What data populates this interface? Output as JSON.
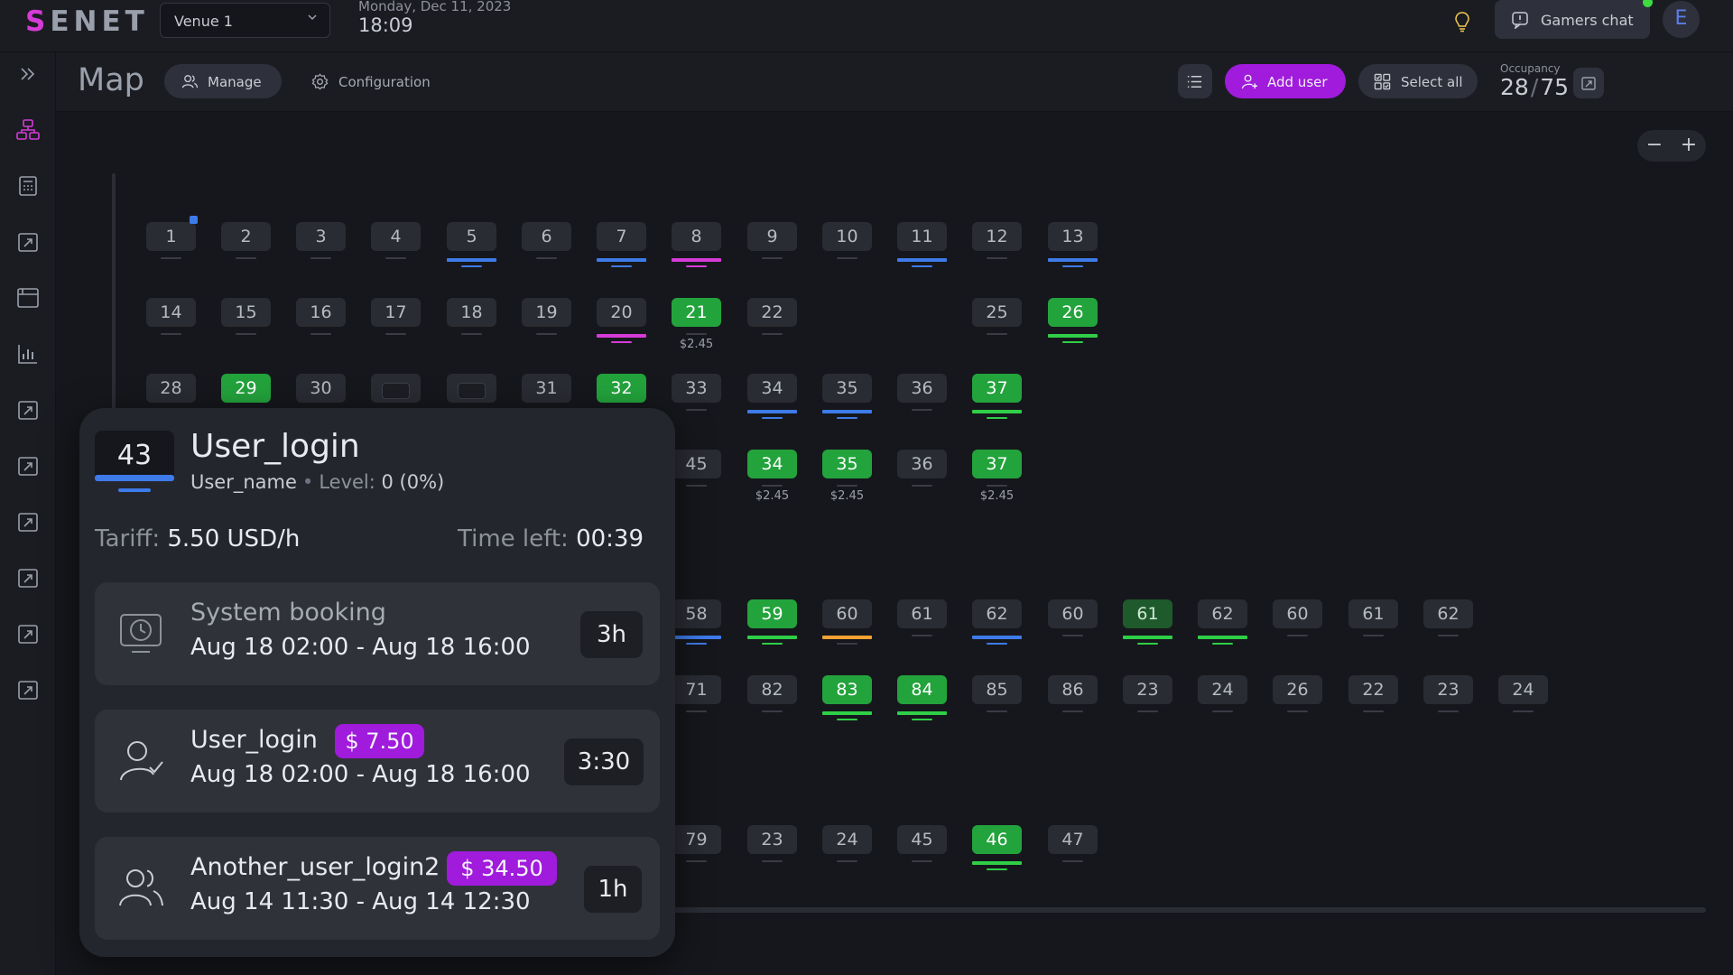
{
  "app": {
    "logo": "SENET",
    "brand_color": "#d63bd8"
  },
  "header": {
    "venue": "Venue 1",
    "date": "Monday, Dec 11, 2023",
    "time": "18:09",
    "gamers_chat": "Gamers chat",
    "avatar_letter": "E",
    "chat_online": true
  },
  "toolbar": {
    "title": "Map",
    "manage": "Manage",
    "configuration": "Configuration",
    "add_user": "Add user",
    "select_all": "Select all",
    "occupancy_label": "Occupancy",
    "occupancy_used": "28",
    "occupancy_sep": "/",
    "occupancy_total": "75"
  },
  "zoom": {
    "out": "−",
    "in": "+"
  },
  "seats": [
    {
      "n": "1",
      "s": "idle",
      "ind": "gray"
    },
    {
      "n": "2",
      "s": "idle",
      "ind": "gray"
    },
    {
      "n": "3",
      "s": "idle",
      "ind": "gray"
    },
    {
      "n": "4",
      "s": "idle",
      "ind": "gray"
    },
    {
      "n": "5",
      "s": "idle",
      "ind": "blue"
    },
    {
      "n": "6",
      "s": "idle",
      "ind": "gray"
    },
    {
      "n": "7",
      "s": "idle",
      "ind": "blue"
    },
    {
      "n": "8",
      "s": "idle",
      "ind": "pink"
    },
    {
      "n": "9",
      "s": "idle",
      "ind": "gray"
    },
    {
      "n": "10",
      "s": "idle",
      "ind": "gray"
    },
    {
      "n": "11",
      "s": "idle",
      "ind": "blue"
    },
    {
      "n": "12",
      "s": "idle",
      "ind": "gray"
    },
    {
      "n": "13",
      "s": "idle",
      "ind": "blue"
    },
    {
      "n": "14",
      "s": "idle",
      "ind": "gray"
    },
    {
      "n": "15",
      "s": "idle",
      "ind": "gray"
    },
    {
      "n": "16",
      "s": "idle",
      "ind": "gray"
    },
    {
      "n": "17",
      "s": "idle",
      "ind": "gray"
    },
    {
      "n": "18",
      "s": "idle",
      "ind": "gray"
    },
    {
      "n": "19",
      "s": "idle",
      "ind": "gray"
    },
    {
      "n": "20",
      "s": "idle",
      "ind": "pink"
    },
    {
      "n": "21",
      "s": "active",
      "ind": "gray",
      "price": "$2.45"
    },
    {
      "n": "22",
      "s": "idle",
      "ind": "gray"
    },
    {
      "n": "25",
      "s": "idle",
      "ind": "gray"
    },
    {
      "n": "26",
      "s": "active",
      "ind": "green"
    },
    {
      "n": "28",
      "s": "idle",
      "ind": "gray"
    },
    {
      "n": "29",
      "s": "active",
      "ind": "gray"
    },
    {
      "n": "30",
      "s": "idle",
      "ind": "gray"
    },
    {
      "n": "",
      "s": "empty",
      "ind": "none"
    },
    {
      "n": "",
      "s": "empty",
      "ind": "none"
    },
    {
      "n": "31",
      "s": "idle",
      "ind": "gray"
    },
    {
      "n": "32",
      "s": "active",
      "ind": "gray"
    },
    {
      "n": "33",
      "s": "idle",
      "ind": "gray"
    },
    {
      "n": "34",
      "s": "idle",
      "ind": "blue"
    },
    {
      "n": "35",
      "s": "idle",
      "ind": "blue"
    },
    {
      "n": "36",
      "s": "idle",
      "ind": "gray"
    },
    {
      "n": "37",
      "s": "active",
      "ind": "green"
    },
    {
      "n": "45",
      "s": "idle",
      "ind": "gray"
    },
    {
      "n": "34",
      "s": "active",
      "ind": "gray",
      "price": "$2.45"
    },
    {
      "n": "35",
      "s": "active",
      "ind": "gray",
      "price": "$2.45"
    },
    {
      "n": "36",
      "s": "idle",
      "ind": "gray"
    },
    {
      "n": "37",
      "s": "active",
      "ind": "gray",
      "price": "$2.45"
    },
    {
      "n": "58",
      "s": "idle",
      "ind": "blue"
    },
    {
      "n": "59",
      "s": "active",
      "ind": "green"
    },
    {
      "n": "60",
      "s": "idle",
      "ind": "orange"
    },
    {
      "n": "61",
      "s": "idle",
      "ind": "gray"
    },
    {
      "n": "62",
      "s": "idle",
      "ind": "blue"
    },
    {
      "n": "60",
      "s": "idle",
      "ind": "gray"
    },
    {
      "n": "61",
      "s": "active-dim",
      "ind": "green"
    },
    {
      "n": "62",
      "s": "idle",
      "ind": "green"
    },
    {
      "n": "60",
      "s": "idle",
      "ind": "gray"
    },
    {
      "n": "61",
      "s": "idle",
      "ind": "gray"
    },
    {
      "n": "62",
      "s": "idle",
      "ind": "gray"
    },
    {
      "n": "71",
      "s": "idle",
      "ind": "gray"
    },
    {
      "n": "82",
      "s": "idle",
      "ind": "gray"
    },
    {
      "n": "83",
      "s": "active",
      "ind": "green"
    },
    {
      "n": "84",
      "s": "active",
      "ind": "green"
    },
    {
      "n": "85",
      "s": "idle",
      "ind": "gray"
    },
    {
      "n": "86",
      "s": "idle",
      "ind": "gray"
    },
    {
      "n": "23",
      "s": "idle",
      "ind": "gray"
    },
    {
      "n": "24",
      "s": "idle",
      "ind": "gray"
    },
    {
      "n": "26",
      "s": "idle",
      "ind": "gray"
    },
    {
      "n": "22",
      "s": "idle",
      "ind": "gray"
    },
    {
      "n": "23",
      "s": "idle",
      "ind": "gray"
    },
    {
      "n": "24",
      "s": "idle",
      "ind": "gray"
    },
    {
      "n": "79",
      "s": "idle",
      "ind": "gray"
    },
    {
      "n": "23",
      "s": "idle",
      "ind": "gray"
    },
    {
      "n": "24",
      "s": "idle",
      "ind": "gray"
    },
    {
      "n": "45",
      "s": "idle",
      "ind": "gray"
    },
    {
      "n": "46",
      "s": "active",
      "ind": "green"
    },
    {
      "n": "47",
      "s": "idle",
      "ind": "gray"
    }
  ],
  "popup": {
    "pc_number": "43",
    "user_login": "User_login",
    "user_name": "User_name",
    "bullet": "•",
    "level_label": "Level:",
    "level_value": "0 (0%)",
    "tariff_label": "Tariff:",
    "tariff_value": "5.50 USD/h",
    "time_left_label": "Time left:",
    "time_left_value": "00:39",
    "bookings": [
      {
        "title": "System booking",
        "range": "Aug 18  02:00  -  Aug 18  16:00",
        "duration": "3h"
      },
      {
        "title": "User_login",
        "amount": "$ 7.50",
        "range": "Aug 18  02:00  -  Aug 18  16:00",
        "duration": "3:30"
      },
      {
        "title": "Another_user_login2",
        "amount": "$ 34.50",
        "range": "Aug 14  11:30  -  Aug 14  12:30",
        "duration": "1h"
      }
    ]
  }
}
